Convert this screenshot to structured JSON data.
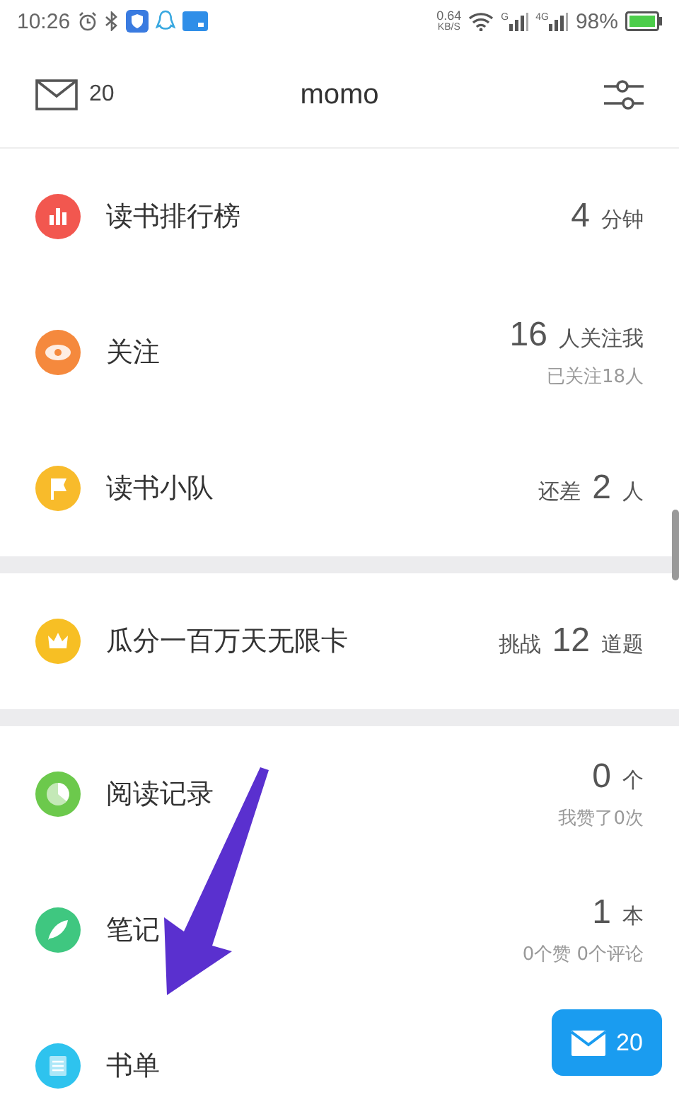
{
  "status_bar": {
    "time": "10:26",
    "speed": "0.64",
    "speed_unit": "KB/S",
    "signal_labels": [
      "G",
      "4G"
    ],
    "battery": "98%"
  },
  "header": {
    "mail_count": "20",
    "title": "momo"
  },
  "groups": [
    {
      "rows": [
        {
          "label": "读书排行榜",
          "color": "#f2574f",
          "value": {
            "number": "4",
            "unit": "分钟"
          }
        },
        {
          "label": "关注",
          "color": "#f5893d",
          "value": {
            "number": "16",
            "unit": "人关注我"
          },
          "sub": "已关注18人"
        },
        {
          "label": "读书小队",
          "color": "#f8bb2b",
          "value": {
            "prefix": "还差",
            "number": "2",
            "unit": "人"
          }
        }
      ]
    },
    {
      "rows": [
        {
          "label": "瓜分一百万天无限卡",
          "color": "#f7bf24",
          "value": {
            "prefix": "挑战",
            "number": "12",
            "unit": "道题"
          }
        }
      ]
    },
    {
      "rows": [
        {
          "label": "阅读记录",
          "color": "#6cc94c",
          "value": {
            "number": "0",
            "unit": "个"
          },
          "sub": "我赞了0次"
        },
        {
          "label": "笔记",
          "color": "#3fc780",
          "value": {
            "number": "1",
            "unit": "本"
          },
          "sub": "0个赞  0个评论"
        },
        {
          "label": "书单",
          "color": "#2ec3ee"
        }
      ]
    }
  ],
  "float_button": {
    "count": "20"
  }
}
